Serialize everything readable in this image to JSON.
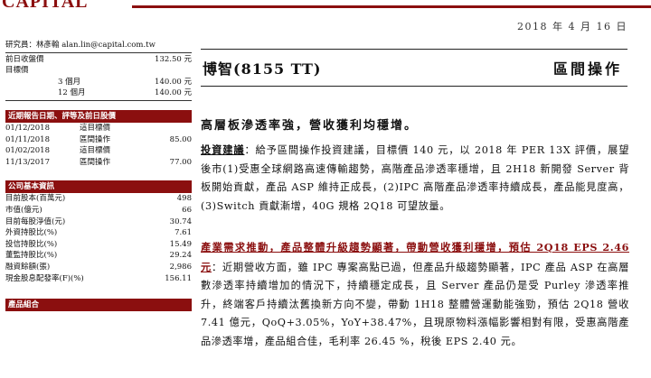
{
  "header": {
    "logo": "CAPITAL",
    "date": "2018 年 4 月 16 日"
  },
  "left": {
    "analyst": "研究員：林彥翰 alan.lin@capital.com.tw",
    "price_rows": [
      {
        "label": "前日收盤價",
        "value": "132.50 元"
      },
      {
        "label": "目標價",
        "value": ""
      }
    ],
    "target_rows": [
      {
        "label": "3 個月",
        "value": "140.00 元"
      },
      {
        "label": "12 個月",
        "value": "140.00 元"
      }
    ],
    "rating_header": "近期報告日期、評等及前日股價",
    "ratings": [
      {
        "date": "01/12/2018",
        "action": "這目標價",
        "price": ""
      },
      {
        "date": "01/11/2018",
        "action": "區間操作",
        "price": "85.00"
      },
      {
        "date": "01/02/2018",
        "action": "這目標價",
        "price": ""
      },
      {
        "date": "11/13/2017",
        "action": "區間操作",
        "price": "77.00"
      }
    ],
    "company_header": "公司基本資訊",
    "company_info": [
      {
        "label": "目前股本(百萬元)",
        "value": "498"
      },
      {
        "label": "市值(億元)",
        "value": "66"
      },
      {
        "label": "目前每股淨值(元)",
        "value": "30.74"
      },
      {
        "label": "外資持股比(%)",
        "value": "7.61"
      },
      {
        "label": "投信持股比(%)",
        "value": "15.49"
      },
      {
        "label": "董監持股比(%)",
        "value": "29.24"
      },
      {
        "label": "融資餘額(張)",
        "value": "2,986"
      },
      {
        "label": "現金股息配發率(F)(%)",
        "value": "156.11"
      }
    ],
    "product_header": "產品組合"
  },
  "main": {
    "company": "博智(8155 TT)",
    "action": "區間操作",
    "headline": "高層板滲透率強，營收獲利均穩增。",
    "p1_lead": "投資建議",
    "p1_text": "：給予區間操作投資建議，目標價 140 元，以 2018 年 PER 13X 評價，展望後市(1)受惠全球網路高速傳輸趨勢，高階產品滲透率穩增，且 2H18 新開發 Server 背板開始貢獻，產品 ASP 維持正成長，(2)IPC 高階產品滲透率持續成長，產品能見度高，(3)Switch 貢獻漸增，40G 規格 2Q18 可望放量。",
    "p2_lead": "產業需求推動，產品整體升級趨勢顯著，帶動營收獲利穩增，預估 2Q18 EPS 2.46 元",
    "p2_text": "：近期營收方面，雖 IPC 專案高點已過，但產品升級趨勢顯著，IPC 產品 ASP 在高層數滲透率持續增加的情況下，持續穩定成長，且 Server 產品仍是受 Purley 滲透率推升，終端客戶持續汰舊換新方向不變，帶動 1H18 整體營運動能強勁，預估 2Q18 營收 7.41 億元，QoQ+3.05%，YoY+38.47%，且現原物料漲幅影響相對有限，受惠高階產品滲透率增，產品組合佳，毛利率 26.45 %，稅後 EPS 2.40 元。"
  }
}
